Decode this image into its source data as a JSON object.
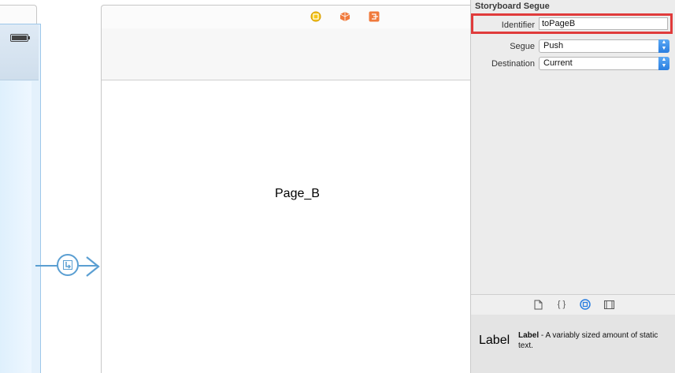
{
  "canvas": {
    "scene_label": "Page_B"
  },
  "inspector": {
    "title": "Storyboard Segue",
    "identifier_label": "Identifier",
    "identifier_value": "toPageB",
    "segue_label": "Segue",
    "segue_value": "Push",
    "destination_label": "Destination",
    "destination_value": "Current"
  },
  "library": {
    "tabs": [
      "file-template-icon",
      "code-snippet-icon",
      "object-library-icon",
      "media-library-icon"
    ],
    "item_big_label": "Label",
    "item_name": "Label",
    "item_description": " - A variably sized amount of static text."
  },
  "colors": {
    "highlight": "#e03b3b",
    "segue": "#5b9fd2",
    "accent": "#2a7ee0"
  }
}
